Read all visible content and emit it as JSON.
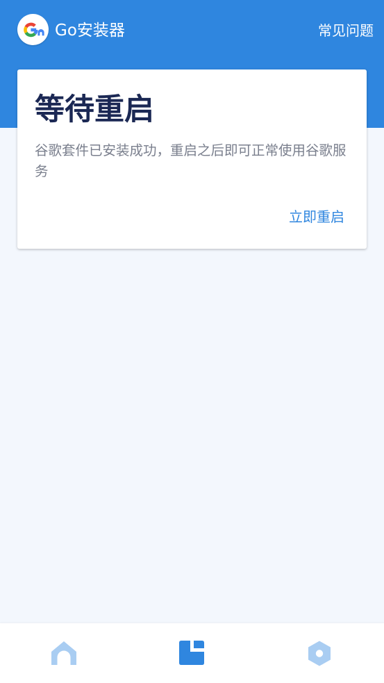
{
  "app_bar": {
    "logo_icon": "google-logo-icon",
    "title": "Go安装器",
    "faq_label": "常见问题"
  },
  "colors": {
    "accent": "#2f86df",
    "background": "#f3f7fd",
    "title_text": "#1b2854",
    "secondary_text": "#7a7f8d",
    "nav_inactive": "#a9cdf2"
  },
  "card": {
    "title": "等待重启",
    "description": "谷歌套件已安装成功，重启之后即可正常使用谷歌服务",
    "action_label": "立即重启"
  },
  "bottom_nav": {
    "items": [
      {
        "icon": "home-icon",
        "active": false
      },
      {
        "icon": "document-icon",
        "active": true
      },
      {
        "icon": "settings-hexagon-icon",
        "active": false
      }
    ]
  }
}
